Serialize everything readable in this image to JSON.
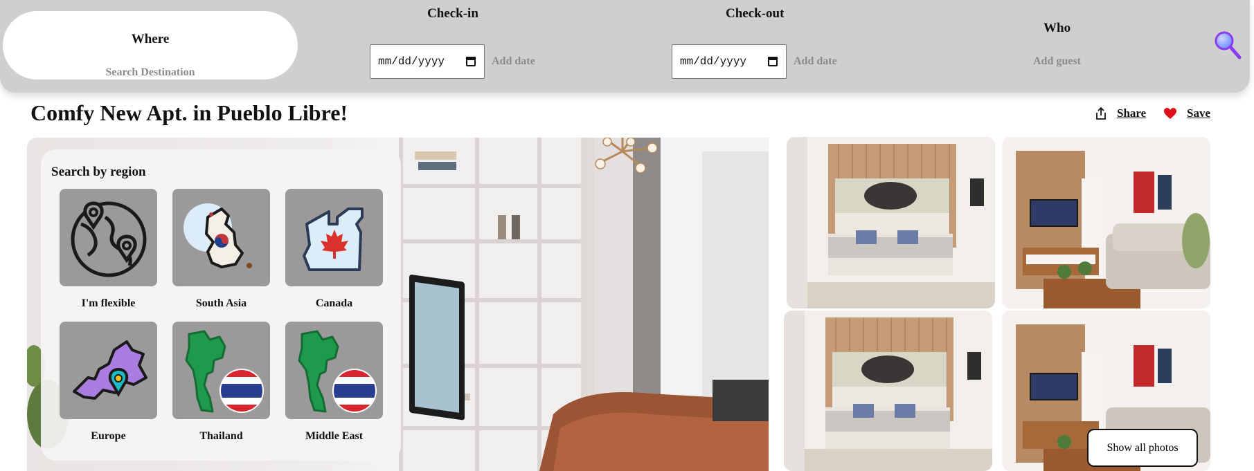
{
  "search": {
    "where_label": "Where",
    "where_placeholder": "Search Destination",
    "checkin_label": "Check-in",
    "checkin_input": "mm/dd/yyyy",
    "checkin_hint": "Add date",
    "checkout_label": "Check-out",
    "checkout_input": "mm/dd/yyyy",
    "checkout_hint": "Add date",
    "who_label": "Who",
    "who_hint": "Add guest",
    "search_icon": "magnifier-icon",
    "accent": "#8a3df0"
  },
  "listing": {
    "title": "Comfy New Apt. in Pueblo Libre!",
    "share_label": "Share",
    "save_label": "Save",
    "heart_color": "#e0101a"
  },
  "regions": {
    "heading": "Search by region",
    "items": [
      {
        "label": "I'm flexible",
        "icon": "globe-pins-icon"
      },
      {
        "label": "South Asia",
        "icon": "korea-map-icon"
      },
      {
        "label": "Canada",
        "icon": "canada-map-icon"
      },
      {
        "label": "Europe",
        "icon": "europe-map-icon"
      },
      {
        "label": "Thailand",
        "icon": "thailand-map-icon"
      },
      {
        "label": "Middle East",
        "icon": "thailand-map-icon"
      }
    ]
  },
  "gallery": {
    "show_all_label": "Show all photos"
  }
}
